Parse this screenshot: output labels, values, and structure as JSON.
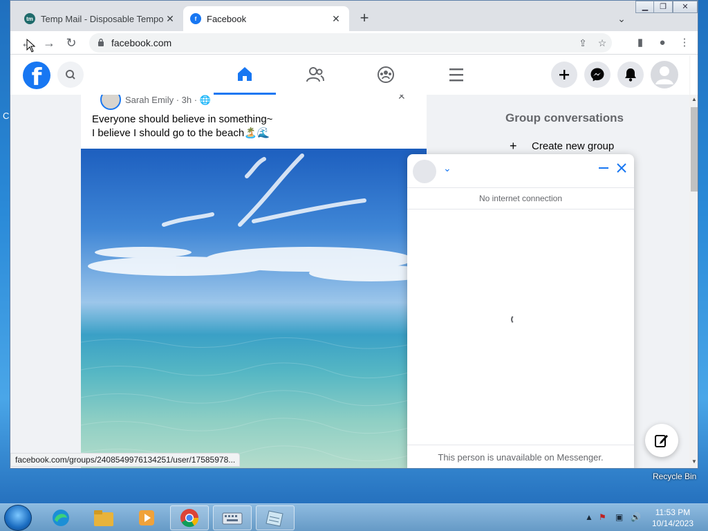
{
  "desktop": {
    "left_glyph": "C",
    "recycle_bin_label": "Recycle Bin"
  },
  "browser": {
    "tabs": [
      {
        "title": "Temp Mail - Disposable Temporar",
        "icon": "temp-mail-icon",
        "active": false
      },
      {
        "title": "Facebook",
        "icon": "facebook-icon",
        "active": true
      }
    ],
    "url": "facebook.com",
    "status_url": "facebook.com/groups/2408549976134251/user/17585978..."
  },
  "facebook": {
    "post": {
      "author": "Sarah Emily",
      "time": "3h",
      "text_line1": "Everyone should believe in something~",
      "text_line2": "I believe I should go to the beach🏝️🌊"
    },
    "sidebar": {
      "group_conversations_title": "Group conversations",
      "create_new_group_label": "Create new group"
    },
    "chat": {
      "status": "No internet connection",
      "footer": "This person is unavailable on Messenger."
    }
  },
  "taskbar": {
    "time": "11:53 PM",
    "date": "10/14/2023"
  },
  "colors": {
    "facebook_blue": "#1877f2",
    "page_bg": "#f0f2f5"
  }
}
